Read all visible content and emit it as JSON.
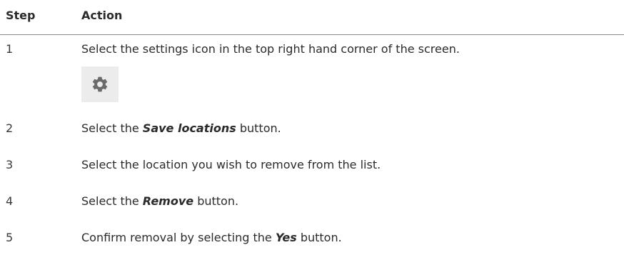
{
  "header": {
    "step_label": "Step",
    "action_label": "Action"
  },
  "rows": [
    {
      "step": "1",
      "action_text": "Select the settings icon in the top right hand corner of the screen.",
      "icon": "gear-icon"
    },
    {
      "step": "2",
      "before": "Select the ",
      "emphasis": "Save locations",
      "after": " button."
    },
    {
      "step": "3",
      "action_text": "Select the location you wish to remove from the list."
    },
    {
      "step": "4",
      "before": "Select the ",
      "emphasis": "Remove",
      "after": " button."
    },
    {
      "step": "5",
      "before": "Confirm removal by selecting the ",
      "emphasis": "Yes",
      "after": " button."
    }
  ],
  "colors": {
    "icon_gray": "#6b6b6b",
    "icon_bg": "#ececec",
    "rule": "#8a8a8a"
  }
}
